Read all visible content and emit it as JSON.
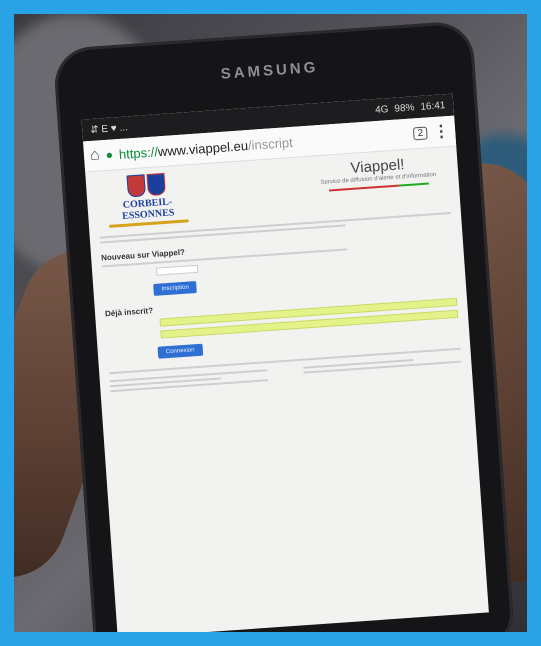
{
  "device": {
    "brand": "SAMSUNG"
  },
  "statusbar": {
    "left_icons": "⇵ E ♥ ...",
    "signal": "4G",
    "battery": "98%",
    "time": "16:41"
  },
  "browser": {
    "url_scheme": "https://",
    "url_host": "www.viappel.eu",
    "url_path": "/inscript",
    "tab_count": "2",
    "menu_icon": "⋮",
    "home_icon": "⌂",
    "lock_icon": "🔒"
  },
  "page": {
    "logo_text": "CORBEIL-ESSONNES",
    "site_title": "Viappel!",
    "tagline": "Service de diffusion d'alerte et d'information",
    "register": {
      "heading": "Nouveau sur Viappel?",
      "button": "Inscription"
    },
    "login": {
      "heading": "Déjà inscrit?",
      "button": "Connexion"
    }
  }
}
